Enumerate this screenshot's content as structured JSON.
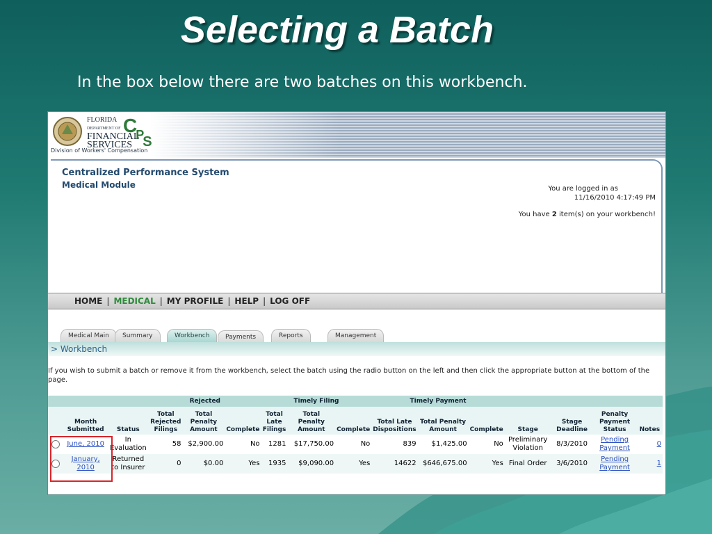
{
  "slide": {
    "title": "Selecting a Batch",
    "subtitle": "In the box below there are two batches on this workbench."
  },
  "app": {
    "logo": {
      "line1": "FLORIDA",
      "line2": "DEPARTMENT OF",
      "line3": "FINANCIAL",
      "line4": "SERVICES",
      "cps": "CPS",
      "division": "Division of Workers' Compensation"
    },
    "system_title": "Centralized Performance System",
    "module": "Medical Module",
    "login_label": "You are logged in as",
    "login_time": "11/16/2010 4:17:49 PM",
    "workbench_prefix": "You have ",
    "workbench_count": "2",
    "workbench_suffix": " item(s) on your workbench!",
    "nav": [
      "HOME",
      "MEDICAL",
      "MY PROFILE",
      "HELP",
      "LOG OFF"
    ],
    "tabs": [
      "Medical Main",
      "Summary",
      "Workbench",
      "Payments",
      "Reports",
      "Management"
    ],
    "active_tab": "Workbench",
    "section_label": "> Workbench",
    "instructions": "If you wish to submit a batch or remove it from the workbench, select the batch using the radio button on the left and then click the appropriate button at the bottom of the page."
  },
  "table": {
    "groups": {
      "rejected": "Rejected",
      "timely_filing": "Timely Filing",
      "timely_payment": "Timely Payment"
    },
    "headers": {
      "month": "Month Submitted",
      "status": "Status",
      "total_rejected": "Total Rejected Filings",
      "rej_penalty": "Total Penalty Amount",
      "rej_complete": "Complete",
      "late_filings": "Total Late Filings",
      "tf_penalty": "Total Penalty Amount",
      "tf_complete": "Complete",
      "late_disp": "Total Late Dispositions",
      "tp_penalty": "Total Penalty Amount",
      "tp_complete": "Complete",
      "stage": "Stage",
      "stage_deadline": "Stage Deadline",
      "penalty_status": "Penalty Payment Status",
      "notes": "Notes"
    },
    "rows": [
      {
        "month": "June, 2010",
        "status": "In Evaluation",
        "total_rejected": "58",
        "rej_penalty": "$2,900.00",
        "rej_complete": "No",
        "late_filings": "1281",
        "tf_penalty": "$17,750.00",
        "tf_complete": "No",
        "late_disp": "839",
        "tp_penalty": "$1,425.00",
        "tp_complete": "No",
        "stage": "Preliminary Violation",
        "stage_deadline": "8/3/2010",
        "penalty_status": "Pending Payment",
        "notes": "0"
      },
      {
        "month": "January, 2010",
        "status": "Returned to Insurer",
        "total_rejected": "0",
        "rej_penalty": "$0.00",
        "rej_complete": "Yes",
        "late_filings": "1935",
        "tf_penalty": "$9,090.00",
        "tf_complete": "Yes",
        "late_disp": "14622",
        "tp_penalty": "$646,675.00",
        "tp_complete": "Yes",
        "stage": "Final Order",
        "stage_deadline": "3/6/2010",
        "penalty_status": "Pending Payment",
        "notes": "1"
      }
    ]
  },
  "colors": {
    "slide_bg": "#1f7a72",
    "accent_green": "#2e8a3a",
    "link_blue": "#2a4fc0",
    "highlight_red": "#d7262b"
  }
}
